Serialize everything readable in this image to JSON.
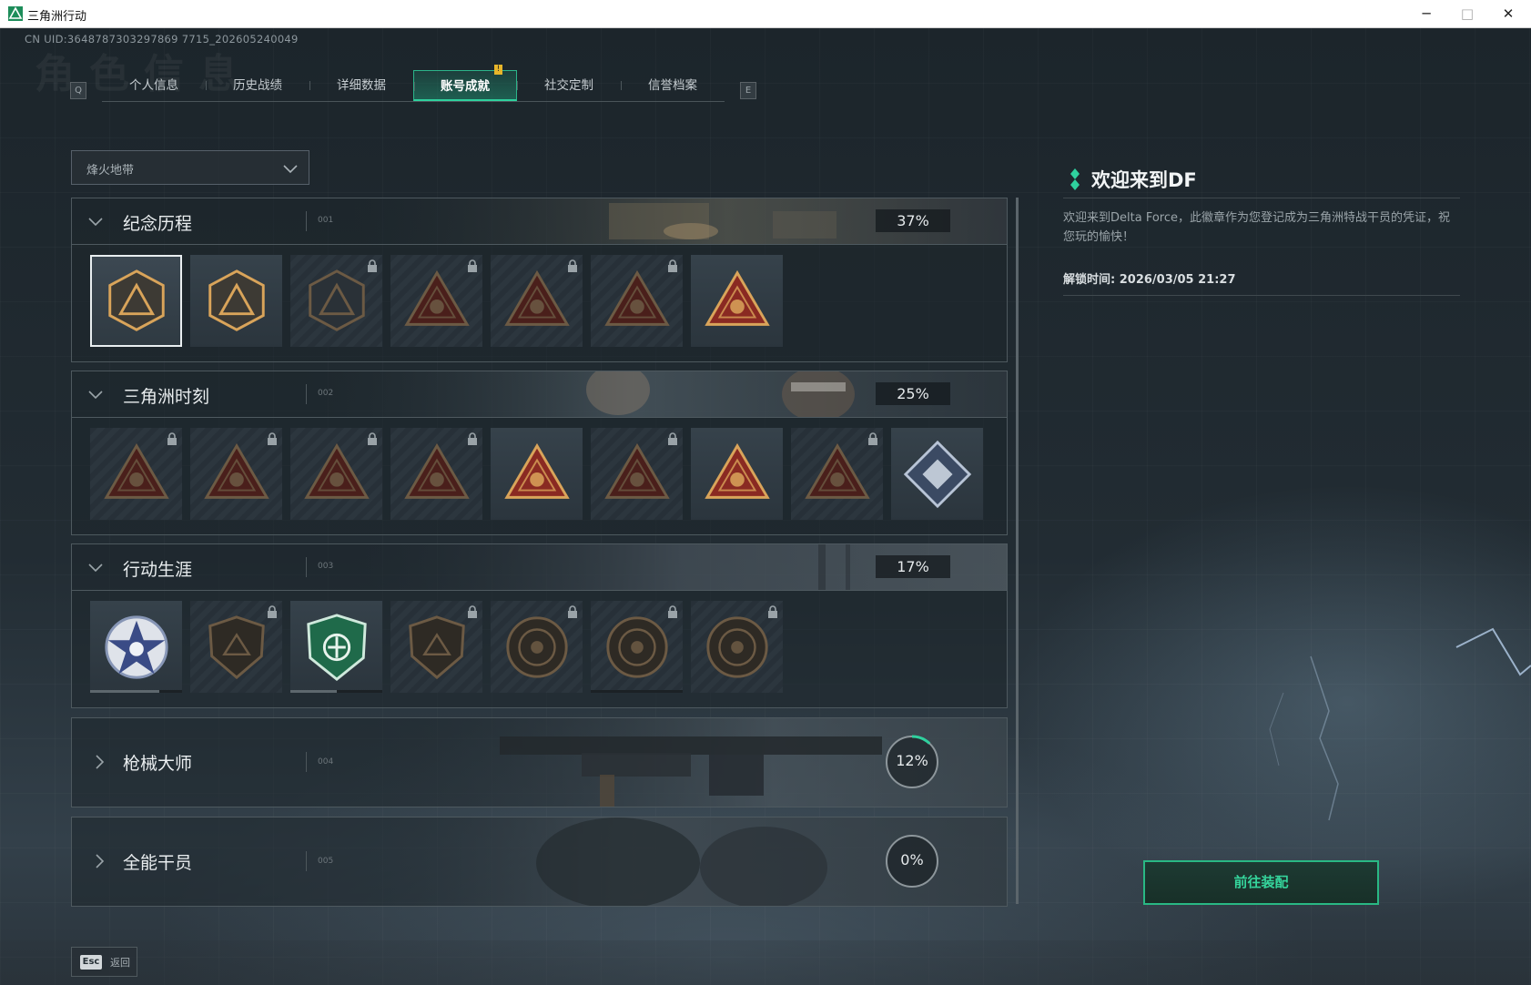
{
  "window": {
    "title": "三角洲行动",
    "minimize": "─",
    "maximize": "□",
    "close": "✕"
  },
  "header": {
    "uid": "CN UID:3648787303297869 7715_202605240049",
    "watermark": "角色信息",
    "key_left": "Q",
    "key_right": "E"
  },
  "tabs": [
    {
      "label": "个人信息",
      "active": false
    },
    {
      "label": "历史战绩",
      "active": false
    },
    {
      "label": "详细数据",
      "active": false
    },
    {
      "label": "账号成就",
      "active": true
    },
    {
      "label": "社交定制",
      "active": false,
      "warning": "!"
    },
    {
      "label": "信誉档案",
      "active": false
    }
  ],
  "mode_select": {
    "value": "烽火地带"
  },
  "sections": [
    {
      "title": "纪念历程",
      "index": "001",
      "progress": "37%",
      "expanded": true,
      "badges": [
        {
          "icon": "delta-triangle-icon",
          "locked": false,
          "selected": true,
          "shape": "hex"
        },
        {
          "icon": "helicopter-icon",
          "locked": false,
          "selected": false,
          "shape": "hex"
        },
        {
          "icon": "emblem-shield-icon",
          "locked": true,
          "selected": false,
          "shape": "hex"
        },
        {
          "icon": "soldier-crate-icon",
          "locked": true,
          "selected": false,
          "shape": "tri"
        },
        {
          "icon": "hooded-figure-icon",
          "locked": true,
          "selected": false,
          "shape": "tri"
        },
        {
          "icon": "crossed-rifles-icon",
          "locked": true,
          "selected": false,
          "shape": "tri"
        },
        {
          "icon": "gold-bag-icon",
          "locked": false,
          "selected": false,
          "shape": "tri"
        }
      ]
    },
    {
      "title": "三角洲时刻",
      "index": "002",
      "progress": "25%",
      "expanded": true,
      "badges": [
        {
          "icon": "operator-icon",
          "locked": true,
          "shape": "tri"
        },
        {
          "icon": "vest-icon",
          "locked": true,
          "shape": "tri"
        },
        {
          "icon": "kneeling-soldier-icon",
          "locked": true,
          "shape": "tri"
        },
        {
          "icon": "d20-dice-icon",
          "locked": true,
          "shape": "tri"
        },
        {
          "icon": "squad-icon",
          "locked": false,
          "shape": "tri"
        },
        {
          "icon": "wolf-emblem-icon",
          "locked": true,
          "shape": "tri"
        },
        {
          "icon": "rocket-icon",
          "locked": false,
          "shape": "tri"
        },
        {
          "icon": "dragon-icon",
          "locked": true,
          "shape": "tri"
        },
        {
          "icon": "crystal-cube-icon",
          "locked": false,
          "shape": "diamond"
        }
      ]
    },
    {
      "title": "行动生涯",
      "index": "003",
      "progress": "17%",
      "expanded": true,
      "badges": [
        {
          "icon": "star-medal-icon",
          "locked": false,
          "shape": "star",
          "progress": 0.75
        },
        {
          "icon": "down-arrow-shield-icon",
          "locked": true,
          "shape": "shield"
        },
        {
          "icon": "green-shield-icon",
          "locked": false,
          "shape": "greenshield",
          "progress": 0.5
        },
        {
          "icon": "hexagram-shield-icon",
          "locked": true,
          "shape": "shield"
        },
        {
          "icon": "clam-coin-icon",
          "locked": true,
          "shape": "coin"
        },
        {
          "icon": "skull-crosshair-icon",
          "locked": true,
          "shape": "coin",
          "progress": 0.0
        },
        {
          "icon": "eye-coin-icon",
          "locked": true,
          "shape": "coin"
        }
      ]
    },
    {
      "title": "枪械大师",
      "index": "004",
      "progress": "12%",
      "progress_value": 0.12,
      "expanded": false
    },
    {
      "title": "全能干员",
      "index": "005",
      "progress": "0%",
      "progress_value": 0.0,
      "expanded": false
    }
  ],
  "detail": {
    "title": "欢迎来到DF",
    "description": "欢迎来到Delta Force，此徽章作为您登记成为三角洲特战干员的凭证，祝您玩的愉快！",
    "unlock_time": "解锁时间: 2026/03/05 21:27"
  },
  "equip_button": "前往装配",
  "footer": {
    "esc_key": "Esc",
    "back_label": "返回"
  },
  "colors": {
    "accent": "#2fd19e",
    "badge_gold": "#d9a45a",
    "badge_red": "#8a2a22",
    "warning": "#e7b52a"
  }
}
